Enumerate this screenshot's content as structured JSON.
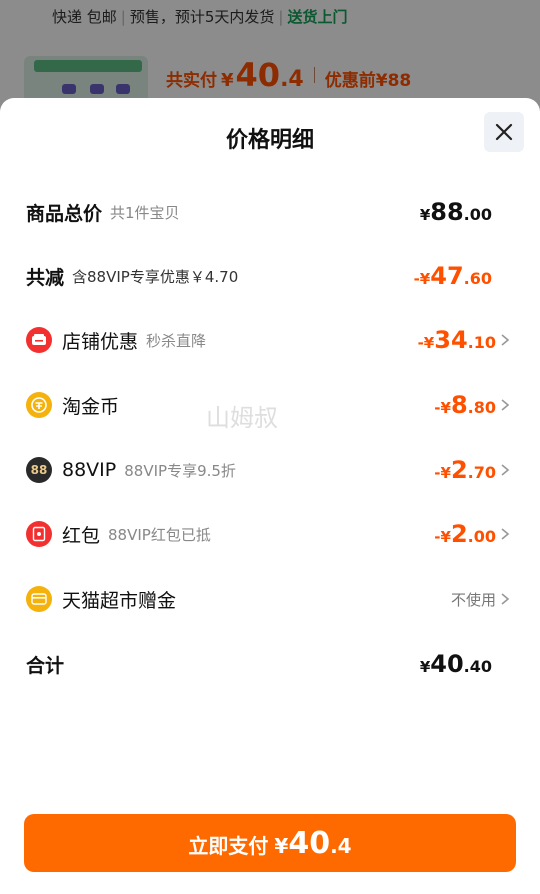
{
  "background": {
    "shipping_text": "快递 包邮",
    "presale_text": "预售，预计5天内发货",
    "delivery_link": "送货上门",
    "paid_label": "共实付",
    "paid_symbol": "¥",
    "paid_int": "40",
    "paid_dec": ".4",
    "before_label": "优惠前",
    "before_price": "¥88"
  },
  "sheet": {
    "title": "价格明细",
    "close_icon": "close-icon"
  },
  "rows": {
    "total": {
      "label": "商品总价",
      "sub": "共1件宝贝",
      "symbol": "¥",
      "int": "88",
      "dec": ".00"
    },
    "discount": {
      "label": "共减",
      "sub": "含88VIP专享优惠￥4.70",
      "symbol": "-¥",
      "int": "47",
      "dec": ".60"
    },
    "shop": {
      "label": "店铺优惠",
      "sub": "秒杀直降",
      "symbol": "-¥",
      "int": "34",
      "dec": ".10",
      "icon": "shop-coupon-icon"
    },
    "coins": {
      "label": "淘金币",
      "sub": "",
      "symbol": "-¥",
      "int": "8",
      "dec": ".80",
      "icon": "gold-coin-icon"
    },
    "vip": {
      "label": "88VIP",
      "sub": "88VIP专享9.5折",
      "symbol": "-¥",
      "int": "2",
      "dec": ".70",
      "icon": "88vip-icon",
      "icon_text": "88"
    },
    "redpacket": {
      "label": "红包",
      "sub": "88VIP红包已抵",
      "symbol": "-¥",
      "int": "2",
      "dec": ".00",
      "icon": "red-packet-icon"
    },
    "gift": {
      "label": "天猫超市赠金",
      "status": "不使用",
      "icon": "gift-card-icon"
    },
    "sum": {
      "label": "合计",
      "symbol": "¥",
      "int": "40",
      "dec": ".40"
    }
  },
  "watermark": "山姆叔",
  "pay_button": {
    "label": "立即支付",
    "symbol": "¥",
    "int": "40",
    "dec": ".4"
  },
  "colors": {
    "accent": "#ff5000",
    "button": "#ff6a00",
    "green": "#17a15a"
  }
}
